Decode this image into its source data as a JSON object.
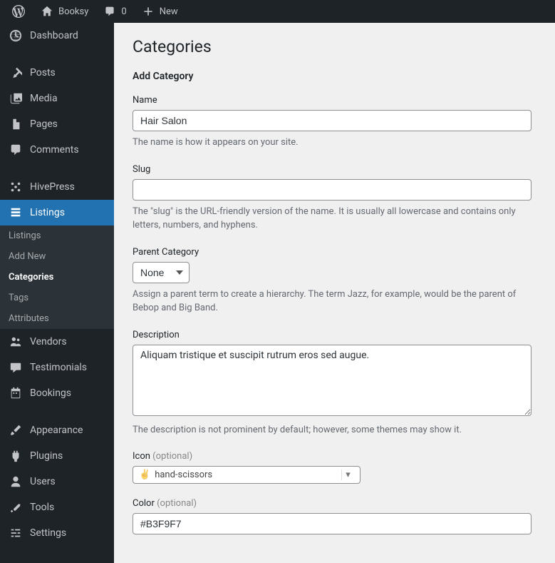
{
  "topbar": {
    "site_name": "Booksy",
    "comments_count": "0",
    "new_label": "New"
  },
  "sidebar": {
    "dashboard": "Dashboard",
    "posts": "Posts",
    "media": "Media",
    "pages": "Pages",
    "comments": "Comments",
    "hivepress": "HivePress",
    "listings": "Listings",
    "submenu": {
      "listings": "Listings",
      "add_new": "Add New",
      "categories": "Categories",
      "tags": "Tags",
      "attributes": "Attributes"
    },
    "vendors": "Vendors",
    "testimonials": "Testimonials",
    "bookings": "Bookings",
    "appearance": "Appearance",
    "plugins": "Plugins",
    "users": "Users",
    "tools": "Tools",
    "settings": "Settings"
  },
  "page": {
    "title": "Categories",
    "subtitle": "Add Category",
    "name": {
      "label": "Name",
      "value": "Hair Salon",
      "help": "The name is how it appears on your site."
    },
    "slug": {
      "label": "Slug",
      "value": "",
      "help": "The \"slug\" is the URL-friendly version of the name. It is usually all lowercase and contains only letters, numbers, and hyphens."
    },
    "parent": {
      "label": "Parent Category",
      "selected": "None",
      "help": "Assign a parent term to create a hierarchy. The term Jazz, for example, would be the parent of Bebop and Big Band."
    },
    "description": {
      "label": "Description",
      "value": "Aliquam tristique et suscipit rutrum eros sed augue.",
      "help": "The description is not prominent by default; however, some themes may show it."
    },
    "icon": {
      "label": "Icon",
      "optional": "(optional)",
      "value": "hand-scissors"
    },
    "color": {
      "label": "Color",
      "optional": "(optional)",
      "value": "#B3F9F7"
    }
  }
}
